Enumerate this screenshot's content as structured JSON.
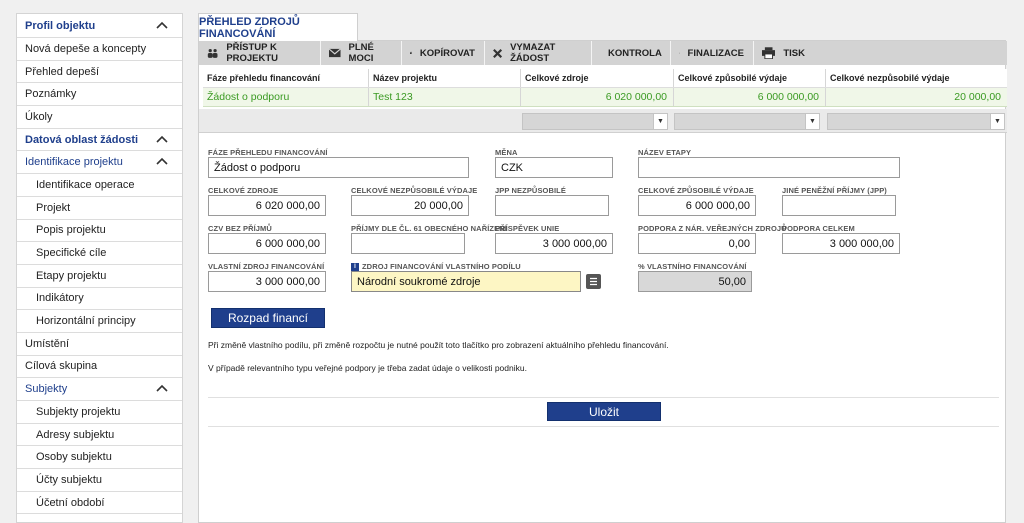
{
  "sidebar": {
    "items": [
      {
        "label": "Profil objektu",
        "kind": "section"
      },
      {
        "label": "Nová depeše a koncepty",
        "kind": "item"
      },
      {
        "label": "Přehled depeší",
        "kind": "item"
      },
      {
        "label": "Poznámky",
        "kind": "item"
      },
      {
        "label": "Úkoly",
        "kind": "item"
      },
      {
        "label": "Datová oblast žádosti",
        "kind": "section"
      },
      {
        "label": "Identifikace projektu",
        "kind": "section-light"
      },
      {
        "label": "Identifikace operace",
        "kind": "sub"
      },
      {
        "label": "Projekt",
        "kind": "sub"
      },
      {
        "label": "Popis projektu",
        "kind": "sub"
      },
      {
        "label": "Specifické cíle",
        "kind": "sub"
      },
      {
        "label": "Etapy projektu",
        "kind": "sub"
      },
      {
        "label": "Indikátory",
        "kind": "sub"
      },
      {
        "label": "Horizontální principy",
        "kind": "sub"
      },
      {
        "label": "Umístění",
        "kind": "item"
      },
      {
        "label": "Cílová skupina",
        "kind": "item"
      },
      {
        "label": "Subjekty",
        "kind": "section-light"
      },
      {
        "label": "Subjekty projektu",
        "kind": "sub"
      },
      {
        "label": "Adresy subjektu",
        "kind": "sub"
      },
      {
        "label": "Osoby subjektu",
        "kind": "sub"
      },
      {
        "label": "Účty subjektu",
        "kind": "sub"
      },
      {
        "label": "Účetní období",
        "kind": "sub"
      }
    ]
  },
  "tab": {
    "label": "PŘEHLED ZDROJŮ FINANCOVÁNÍ"
  },
  "toolbar": {
    "access": "PŘÍSTUP K PROJEKTU",
    "powers": "PLNÉ MOCI",
    "copy": "KOPÍROVAT",
    "delete": "VYMAZAT ŽÁDOST",
    "check": "KONTROLA",
    "finalize": "FINALIZACE",
    "print": "TISK"
  },
  "grid": {
    "headers": [
      "Fáze přehledu financování",
      "Název projektu",
      "Celkové zdroje",
      "Celkové způsobilé výdaje",
      "Celkové nezpůsobilé výdaje"
    ],
    "row": [
      "Žádost o podporu",
      "Test 123",
      "6 020 000,00",
      "6 000 000,00",
      "20 000,00"
    ]
  },
  "form": {
    "faze_label": "FÁZE PŘEHLEDU FINANCOVÁNÍ",
    "faze_value": "Žádost o podporu",
    "mena_label": "MĚNA",
    "mena_value": "CZK",
    "etapa_label": "NÁZEV ETAPY",
    "etapa_value": "",
    "zdroje_label": "CELKOVÉ ZDROJE",
    "zdroje_value": "6 020 000,00",
    "nezp_label": "CELKOVÉ NEZPŮSOBILÉ VÝDAJE",
    "nezp_value": "20 000,00",
    "jpp_nezp_label": "JPP NEZPŮSOBILÉ",
    "jpp_nezp_value": "",
    "zpus_label": "CELKOVÉ ZPŮSOBILÉ VÝDAJE",
    "zpus_value": "6 000 000,00",
    "jine_label": "JINÉ PENĚŽNÍ PŘÍJMY (JPP)",
    "jine_value": "",
    "czv_label": "CZV BEZ PŘÍJMŮ",
    "czv_value": "6 000 000,00",
    "prijmy61_label": "PŘÍJMY DLE ČL. 61 OBECNÉHO NAŘÍZENÍ",
    "prijmy61_value": "",
    "eu_label": "PŘÍSPĚVEK UNIE",
    "eu_value": "3 000 000,00",
    "nar_label": "PODPORA Z NÁR. VEŘEJNÝCH ZDROJŮ",
    "nar_value": "0,00",
    "celkem_label": "PODPORA CELKEM",
    "celkem_value": "3 000 000,00",
    "vlastni_label": "VLASTNÍ ZDROJ FINANCOVÁNÍ",
    "vlastni_value": "3 000 000,00",
    "zdroj_vl_label": "ZDROJ FINANCOVÁNÍ VLASTNÍHO PODÍLU",
    "zdroj_vl_value": "Národní soukromé zdroje",
    "pct_label": "% VLASTNÍHO FINANCOVÁNÍ",
    "pct_value": "50,00"
  },
  "buttons": {
    "rozpad": "Rozpad financí",
    "ulozit": "Uložit"
  },
  "notes": {
    "n1": "Při změně vlastního podílu, při změně rozpočtu je nutné použít toto tlačítko pro zobrazení aktuálního přehledu financování.",
    "n2": "V případě relevantního typu veřejné podpory je třeba zadat údaje o velikosti podniku."
  },
  "colors": {
    "accent": "#1f3f8c",
    "selected_text": "#3a9a22",
    "highlight_field": "#fdf6c4"
  }
}
